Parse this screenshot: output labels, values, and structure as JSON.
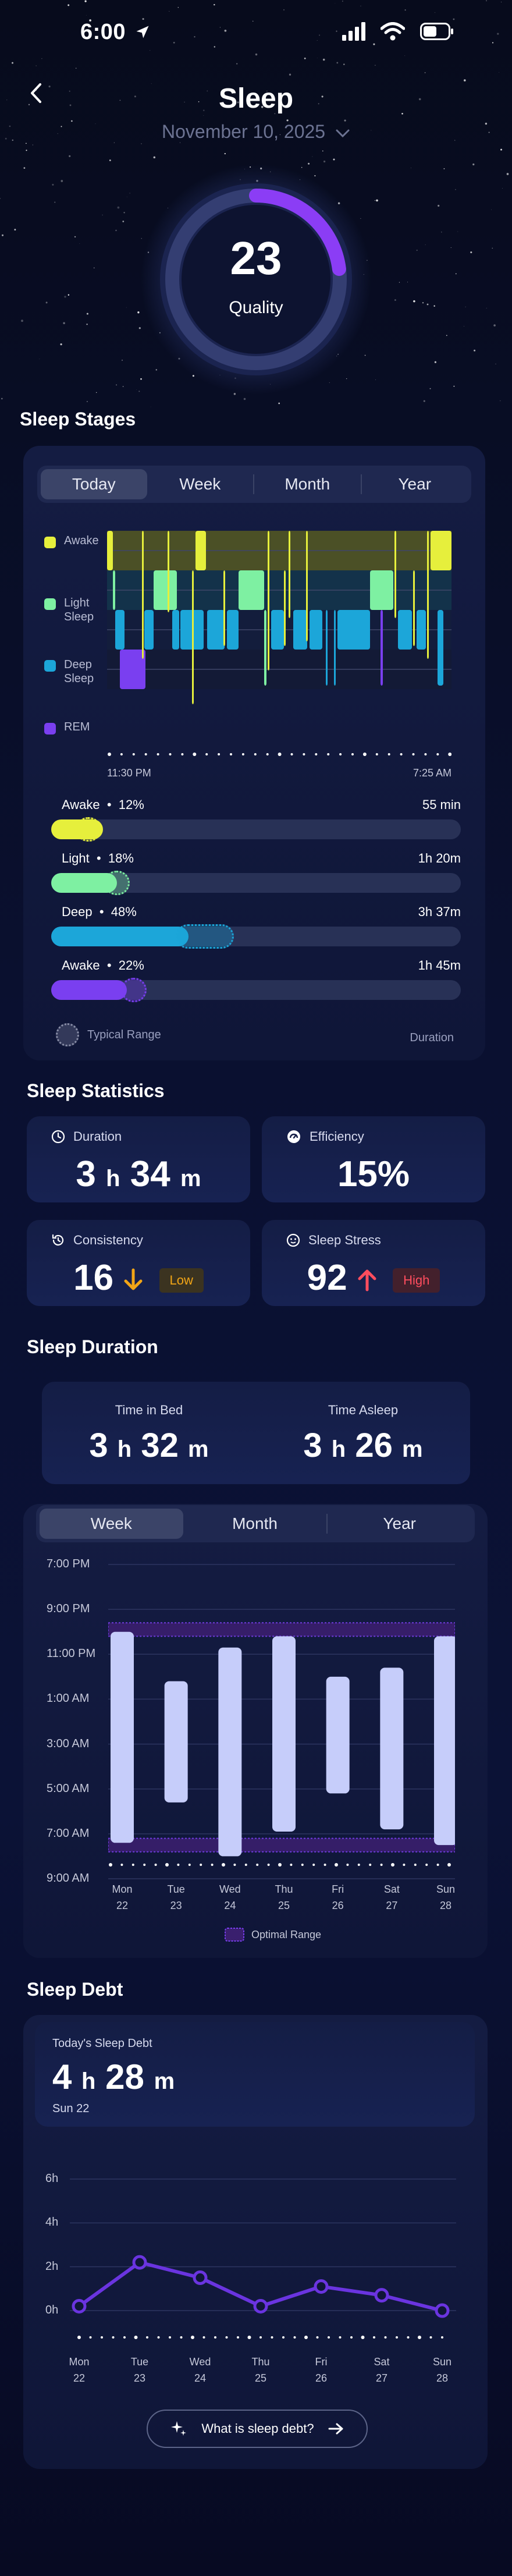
{
  "status_bar": {
    "time": "6:00"
  },
  "header": {
    "title": "Sleep",
    "date": "November 10, 2025"
  },
  "quality": {
    "score": "23",
    "label": "Quality",
    "fraction": 0.23
  },
  "sleep_stages": {
    "title": "Sleep Stages",
    "tabs": [
      "Today",
      "Week",
      "Month",
      "Year"
    ],
    "active_tab": "Today",
    "legend": [
      {
        "label": "Awake",
        "color": "#e6ef3c"
      },
      {
        "label": "Light Sleep",
        "color": "#7ef0a2"
      },
      {
        "label": "Deep Sleep",
        "color": "#1ca6d9"
      },
      {
        "label": "REM",
        "color": "#7a3ff0"
      }
    ],
    "start_time": "11:30 PM",
    "end_time": "7:25 AM",
    "stages": [
      {
        "name": "Awake",
        "percent": "12%",
        "duration": "55 min",
        "value": 0.12,
        "typical": 0.06,
        "color": "#e6ef3c"
      },
      {
        "name": "Light",
        "percent": "18%",
        "duration": "1h 20m",
        "value": 0.18,
        "typical": 0.18,
        "color": "#7ef0a2"
      },
      {
        "name": "Deep",
        "percent": "48%",
        "duration": "3h 37m",
        "value": 0.48,
        "typical": 0.48,
        "color": "#1ca6d9"
      },
      {
        "name": "Awake",
        "percent": "22%",
        "duration": "1h 45m",
        "value": 0.22,
        "typical": 0.25,
        "color": "#7a3ff0"
      }
    ],
    "typical_label": "Typical Range",
    "duration_label": "Duration"
  },
  "sleep_statistics": {
    "title": "Sleep Statistics",
    "duration": {
      "label": "Duration",
      "hours": "3",
      "h": "h",
      "minutes": "34",
      "m": "m"
    },
    "efficiency": {
      "label": "Efficiency",
      "value": "15%"
    },
    "consistency": {
      "label": "Consistency",
      "value": "16",
      "badge": "Low"
    },
    "stress": {
      "label": "Sleep Stress",
      "value": "92",
      "badge": "High"
    }
  },
  "sleep_duration": {
    "title": "Sleep Duration",
    "time_in_bed": {
      "label": "Time in Bed",
      "hours": "3",
      "h": "h",
      "minutes": "32",
      "m": "m"
    },
    "time_asleep": {
      "label": "Time Asleep",
      "hours": "3",
      "h": "h",
      "minutes": "26",
      "m": "m"
    },
    "tabs": [
      "Week",
      "Month",
      "Year"
    ],
    "active_tab": "Week",
    "y_labels": [
      "7:00 PM",
      "9:00 PM",
      "11:00 PM",
      "1:00 AM",
      "3:00 AM",
      "5:00 AM",
      "7:00 AM",
      "9:00 AM"
    ],
    "optimal_label": "Optimal Range"
  },
  "sleep_debt": {
    "title": "Sleep Debt",
    "today_label": "Today's Sleep Debt",
    "hours": "4",
    "h": "h",
    "minutes": "28",
    "m": "m",
    "day": "Sun 22",
    "y_labels": [
      "6h",
      "4h",
      "2h",
      "0h"
    ],
    "button_label": "What is sleep debt?"
  },
  "chart_data": [
    {
      "type": "bar",
      "title": "",
      "categories": [
        "Mon 22",
        "Tue 23",
        "Wed 24",
        "Thu 25",
        "Fri 26",
        "Sat 27",
        "Sun 28"
      ],
      "day_names": [
        "Mon",
        "Tue",
        "Wed",
        "Thu",
        "Fri",
        "Sat",
        "Sun"
      ],
      "day_numbers": [
        "22",
        "23",
        "24",
        "25",
        "26",
        "27",
        "28"
      ],
      "series": [
        {
          "values_start_hours_after_7pm": [
            3.0,
            5.2,
            3.7,
            3.2,
            5.0,
            4.6,
            3.2
          ],
          "values_end_hours_after_7pm": [
            12.4,
            10.6,
            13.0,
            11.9,
            10.2,
            11.8,
            12.5
          ]
        }
      ],
      "optimal_range_hours_after_7pm": [
        [
          2.6,
          3.2
        ],
        [
          12.2,
          12.8
        ]
      ],
      "ylim": [
        0,
        14
      ]
    },
    {
      "type": "line",
      "title": "",
      "categories": [
        "Mon 22",
        "Tue 23",
        "Wed 24",
        "Thu 25",
        "Fri 26",
        "Sat 27",
        "Sun 28"
      ],
      "day_names": [
        "Mon",
        "Tue",
        "Wed",
        "Thu",
        "Fri",
        "Sat",
        "Sun"
      ],
      "day_numbers": [
        "22",
        "23",
        "24",
        "25",
        "26",
        "27",
        "28"
      ],
      "values": [
        0.2,
        2.2,
        1.5,
        0.2,
        1.1,
        0.7,
        0.0
      ],
      "ylim": [
        0,
        6
      ]
    }
  ],
  "colors": {
    "accent": "#8b3df5",
    "awake": "#e6ef3c",
    "light": "#7ef0a2",
    "deep": "#1ca6d9",
    "rem": "#7a3ff0",
    "bar": "#c6cdfa",
    "low": "#f2a516",
    "high": "#ff4d5e"
  }
}
